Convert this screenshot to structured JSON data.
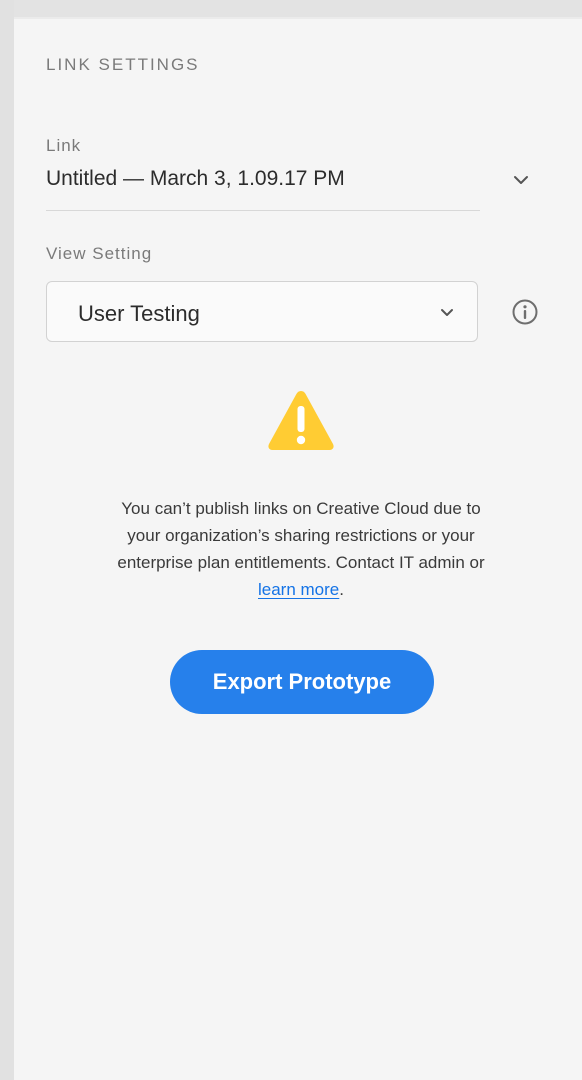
{
  "panel": {
    "title": "LINK SETTINGS"
  },
  "link": {
    "label": "Link",
    "value": "Untitled — March 3, 1.09.17 PM",
    "dropdown_icon": "chevron-down-icon"
  },
  "view_setting": {
    "label": "View Setting",
    "value": "User Testing",
    "dropdown_icon": "chevron-down-icon",
    "info_icon": "info-icon"
  },
  "warning": {
    "icon": "warning-icon",
    "icon_color": "#ffcc33",
    "line1": "You can’t publish links on Creative Cloud due to",
    "line2": "your organization’s sharing restrictions or your",
    "line3": "enterprise plan entitlements. Contact IT admin or",
    "link_text": "learn more",
    "trailing": "."
  },
  "export_button": {
    "label": "Export Prototype",
    "color": "#2680eb"
  }
}
